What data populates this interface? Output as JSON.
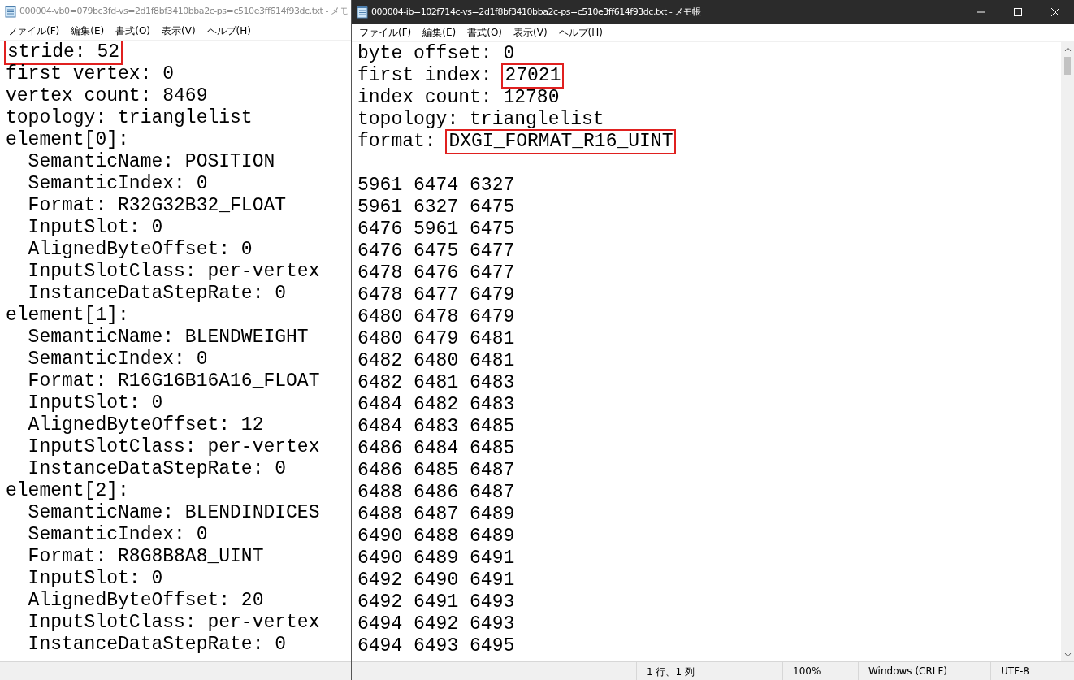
{
  "windows": [
    {
      "title": "000004-vb0=079bc3fd-vs=2d1f8bf3410bba2c-ps=c510e3ff614f93dc.txt - メモ",
      "active": false,
      "menu": [
        "ファイル(F)",
        "編集(E)",
        "書式(O)",
        "表示(V)",
        "ヘルプ(H)"
      ],
      "lines": [
        {
          "boxed_text": "stride: 52"
        },
        {
          "text": "first vertex: 0"
        },
        {
          "text": "vertex count: 8469"
        },
        {
          "text": "topology: trianglelist"
        },
        {
          "text": "element[0]:"
        },
        {
          "text": "  SemanticName: POSITION"
        },
        {
          "text": "  SemanticIndex: 0"
        },
        {
          "text": "  Format: R32G32B32_FLOAT"
        },
        {
          "text": "  InputSlot: 0"
        },
        {
          "text": "  AlignedByteOffset: 0"
        },
        {
          "text": "  InputSlotClass: per-vertex"
        },
        {
          "text": "  InstanceDataStepRate: 0"
        },
        {
          "text": "element[1]:"
        },
        {
          "text": "  SemanticName: BLENDWEIGHT"
        },
        {
          "text": "  SemanticIndex: 0"
        },
        {
          "text": "  Format: R16G16B16A16_FLOAT"
        },
        {
          "text": "  InputSlot: 0"
        },
        {
          "text": "  AlignedByteOffset: 12"
        },
        {
          "text": "  InputSlotClass: per-vertex"
        },
        {
          "text": "  InstanceDataStepRate: 0"
        },
        {
          "text": "element[2]:"
        },
        {
          "text": "  SemanticName: BLENDINDICES"
        },
        {
          "text": "  SemanticIndex: 0"
        },
        {
          "text": "  Format: R8G8B8A8_UINT"
        },
        {
          "text": "  InputSlot: 0"
        },
        {
          "text": "  AlignedByteOffset: 20"
        },
        {
          "text": "  InputSlotClass: per-vertex"
        },
        {
          "text": "  InstanceDataStepRate: 0"
        }
      ]
    },
    {
      "title": "000004-ib=102f714c-vs=2d1f8bf3410bba2c-ps=c510e3ff614f93dc.txt - メモ帳",
      "active": true,
      "menu": [
        "ファイル(F)",
        "編集(E)",
        "書式(O)",
        "表示(V)",
        "ヘルプ(H)"
      ],
      "lines": [
        {
          "text": "byte offset: 0"
        },
        {
          "text": "first index: ",
          "boxed_text": "27021"
        },
        {
          "text": "index count: 12780"
        },
        {
          "text": "topology: trianglelist"
        },
        {
          "text": "format: ",
          "boxed_text": "DXGI_FORMAT_R16_UINT"
        }
      ],
      "body_lines": [
        {
          "text": "5961 6474 6327"
        },
        {
          "text": "5961 6327 6475"
        },
        {
          "text": "6476 5961 6475"
        },
        {
          "text": "6476 6475 6477"
        },
        {
          "text": "6478 6476 6477"
        },
        {
          "text": "6478 6477 6479"
        },
        {
          "text": "6480 6478 6479"
        },
        {
          "text": "6480 6479 6481"
        },
        {
          "text": "6482 6480 6481"
        },
        {
          "text": "6482 6481 6483"
        },
        {
          "text": "6484 6482 6483"
        },
        {
          "text": "6484 6483 6485"
        },
        {
          "text": "6486 6484 6485"
        },
        {
          "text": "6486 6485 6487"
        },
        {
          "text": "6488 6486 6487"
        },
        {
          "text": "6488 6487 6489"
        },
        {
          "text": "6490 6488 6489"
        },
        {
          "text": "6490 6489 6491"
        },
        {
          "text": "6492 6490 6491"
        },
        {
          "text": "6492 6491 6493"
        },
        {
          "text": "6494 6492 6493"
        },
        {
          "text": "6494 6493 6495"
        }
      ],
      "status_bar": [
        "1 行、1 列",
        "100%",
        "Windows (CRLF)",
        "UTF-8"
      ]
    }
  ]
}
